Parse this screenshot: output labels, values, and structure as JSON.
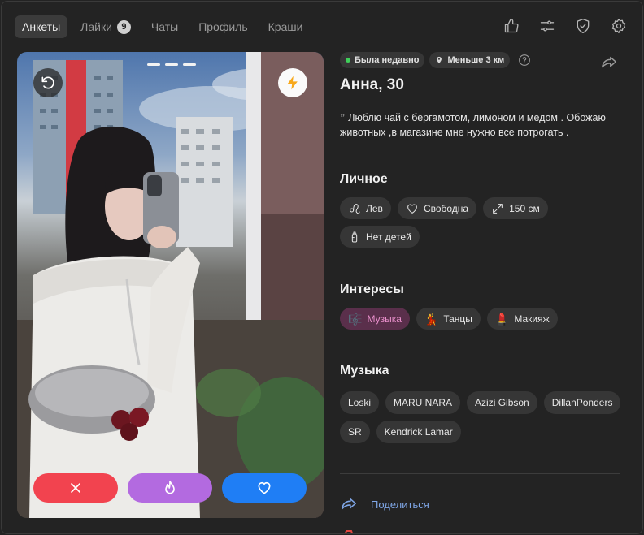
{
  "nav": {
    "tabs": [
      {
        "label": "Анкеты",
        "active": true
      },
      {
        "label": "Лайки",
        "badge": "9"
      },
      {
        "label": "Чаты"
      },
      {
        "label": "Профиль"
      },
      {
        "label": "Краши"
      }
    ],
    "right_icons": [
      "thumbs-up-icon",
      "sliders-icon",
      "shield-check-icon",
      "gear-icon"
    ]
  },
  "photo": {
    "progress_segments": 3,
    "left_icon": "undo-icon",
    "right_icon": "lightning-icon",
    "actions": [
      "close-icon",
      "flame-icon",
      "heart-icon"
    ],
    "colors": {
      "dislike": "#f2434f",
      "super": "#b36ae0",
      "like": "#1f7ef5"
    }
  },
  "profile": {
    "status_online": "Была недавно",
    "status_distance": "Меньше 3 км",
    "name": "Анна, 30",
    "bio": "Люблю чай с бергамотом, лимоном и медом . Обожаю животных ,в магазине мне нужно все потрогать ."
  },
  "sections": {
    "personal": {
      "title": "Личное",
      "items": [
        {
          "label": "Лев",
          "icon": "leo-zodiac-icon"
        },
        {
          "label": "Свободна",
          "icon": "heart-outline-icon"
        },
        {
          "label": "150 см",
          "icon": "expand-arrows-icon"
        },
        {
          "label": "Нет детей",
          "icon": "baby-bottle-icon"
        }
      ]
    },
    "interests": {
      "title": "Интересы",
      "items": [
        {
          "label": "Музыка",
          "emoji": "🎼",
          "active": true
        },
        {
          "label": "Танцы",
          "emoji": "💃"
        },
        {
          "label": "Макияж",
          "emoji": "💄"
        }
      ]
    },
    "music": {
      "title": "Музыка",
      "items": [
        "Loski",
        "MARU NARA",
        "Azizi Gibson",
        "DillanPonders",
        "SR",
        "Kendrick Lamar"
      ]
    }
  },
  "share": {
    "label": "Поделиться"
  }
}
